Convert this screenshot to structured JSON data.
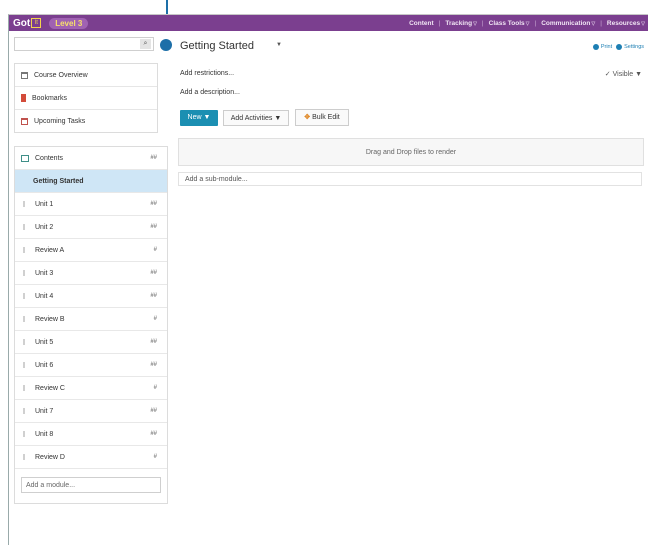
{
  "navbar": {
    "logo_text": "Got",
    "logo_mark": "It",
    "level_badge": "Level 3",
    "links": [
      {
        "label": "Content",
        "has_dropdown": false
      },
      {
        "label": "Tracking",
        "has_dropdown": true
      },
      {
        "label": "Class Tools",
        "has_dropdown": true
      },
      {
        "label": "Communication",
        "has_dropdown": true
      },
      {
        "label": "Resources",
        "has_dropdown": true
      }
    ],
    "dropdown_glyph": "▽",
    "separator": "|"
  },
  "search": {
    "placeholder": "",
    "icon": "search-icon",
    "glyph": "🔍"
  },
  "quick_links": [
    {
      "label": "Course Overview",
      "icon": "overview-icon"
    },
    {
      "label": "Bookmarks",
      "icon": "bookmark-icon"
    },
    {
      "label": "Upcoming Tasks",
      "icon": "calendar-icon"
    }
  ],
  "toc": {
    "header": {
      "label": "Contents",
      "count": "##"
    },
    "selected": "Getting Started",
    "items": [
      {
        "label": "Unit 1",
        "count": "##"
      },
      {
        "label": "Unit 2",
        "count": "##"
      },
      {
        "label": "Review A",
        "count": "#"
      },
      {
        "label": "Unit 3",
        "count": "##"
      },
      {
        "label": "Unit 4",
        "count": "##"
      },
      {
        "label": "Review B",
        "count": "#"
      },
      {
        "label": "Unit 5",
        "count": "##"
      },
      {
        "label": "Unit 6",
        "count": "##"
      },
      {
        "label": "Review C",
        "count": "#"
      },
      {
        "label": "Unit 7",
        "count": "##"
      },
      {
        "label": "Unit 8",
        "count": "##"
      },
      {
        "label": "Review D",
        "count": "#"
      }
    ],
    "add_module": "Add a module..."
  },
  "main": {
    "title": "Getting Started",
    "title_caret": "▼",
    "print_label": "Print",
    "settings_label": "Settings",
    "add_restrictions": "Add restrictions...",
    "visible_label": "✓ Visible",
    "visible_caret": "▼",
    "add_description": "Add a description...",
    "new_button": "New",
    "new_caret": "▼",
    "add_activities": "Add Activities",
    "add_activities_caret": "▼",
    "bulk_edit": "Bulk Edit",
    "bulk_icon": "✥",
    "drop_zone": "Drag and Drop files to render",
    "add_sub_module": "Add a sub-module..."
  },
  "colors": {
    "navbar": "#7b3f8f",
    "level_badge_text": "#f7e06b",
    "primary_button": "#1b8fb2",
    "selected_row": "#cfe6f6",
    "pointer": "#1d6fa8"
  }
}
